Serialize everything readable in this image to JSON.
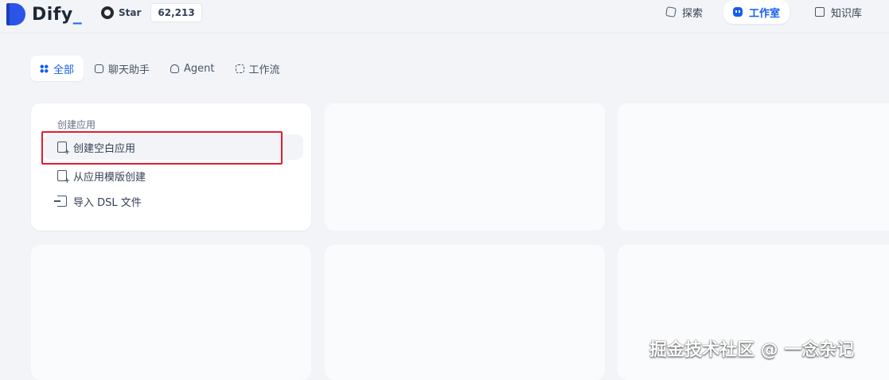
{
  "app": {
    "name": "Dify",
    "cursor": "_"
  },
  "github": {
    "label": "Star",
    "count": "62,213"
  },
  "nav": {
    "items": [
      {
        "label": "探索",
        "icon": "explore-icon"
      },
      {
        "label": "工作室",
        "icon": "studio-icon"
      },
      {
        "label": "知识库",
        "icon": "knowledge-icon"
      }
    ]
  },
  "tabs": [
    {
      "label": "全部",
      "icon": "grid-icon"
    },
    {
      "label": "聊天助手",
      "icon": "chat-icon"
    },
    {
      "label": "Agent",
      "icon": "agent-icon"
    },
    {
      "label": "工作流",
      "icon": "workflow-icon"
    }
  ],
  "create_menu": {
    "title": "创建应用",
    "items": [
      {
        "label": "创建空白应用",
        "icon": "blank-file-icon"
      },
      {
        "label": "从应用模版创建",
        "icon": "template-icon"
      },
      {
        "label": "导入 DSL 文件",
        "icon": "import-icon"
      }
    ]
  },
  "watermark": "掘金技术社区 @ 一念杂记",
  "colors": {
    "accent": "#155eef",
    "highlight_box": "#e11d2e",
    "background": "#f2f4f7"
  }
}
